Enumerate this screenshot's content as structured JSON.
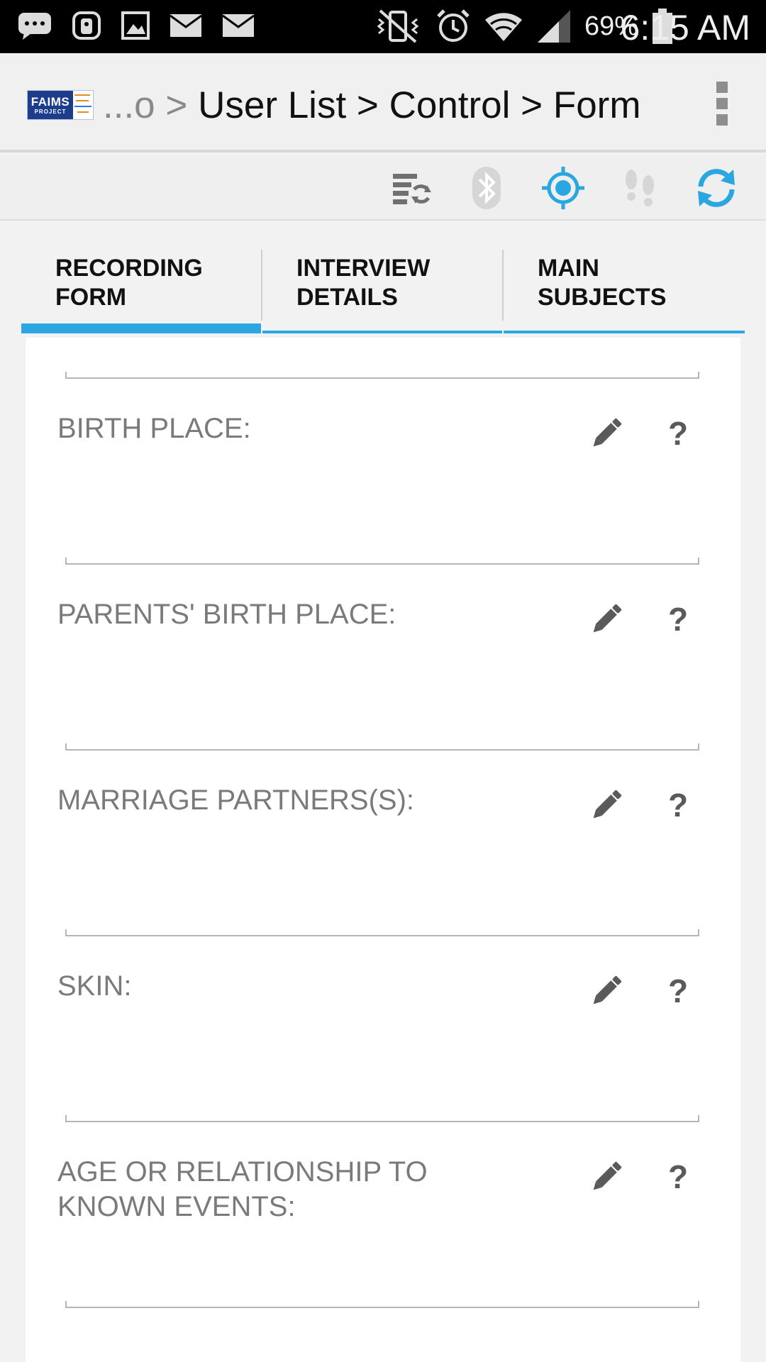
{
  "status_bar": {
    "battery_percent": "69%",
    "time": "6:15 AM",
    "icons": [
      "chat-icon",
      "app-icon",
      "image-icon",
      "mail-icon",
      "mail-icon",
      "mute-vibrate-icon",
      "alarm-icon",
      "wifi-icon",
      "signal-icon",
      "battery-icon"
    ]
  },
  "action_bar": {
    "logo_text": "FAIMS",
    "logo_subtext": "PROJECT",
    "breadcrumb_muted": "...o > ",
    "breadcrumb_main": "User List > Control > Form",
    "overflow_icon": "overflow-menu-icon"
  },
  "toolbar": {
    "icons": [
      "sync-list-icon",
      "bluetooth-icon",
      "gps-icon",
      "tracking-icon",
      "sync-icon"
    ],
    "colors": {
      "active": "#2aa7e1",
      "inactive": "#cfcfcf",
      "dark": "#707070"
    }
  },
  "tabs": [
    {
      "label": "RECORDING\nFORM",
      "active": true
    },
    {
      "label": "INTERVIEW\nDETAILS",
      "active": false
    },
    {
      "label": "MAIN\nSUBJECTS",
      "active": false
    }
  ],
  "fields": [
    {
      "label": "BIRTH PLACE:",
      "help": "?"
    },
    {
      "label": "PARENTS' BIRTH PLACE:",
      "help": "?"
    },
    {
      "label": "MARRIAGE PARTNERS(S):",
      "help": "?"
    },
    {
      "label": "SKIN:",
      "help": "?"
    },
    {
      "label": "AGE OR RELATIONSHIP TO\nKNOWN EVENTS:",
      "help": "?"
    }
  ],
  "accent_color": "#2aa7e1"
}
